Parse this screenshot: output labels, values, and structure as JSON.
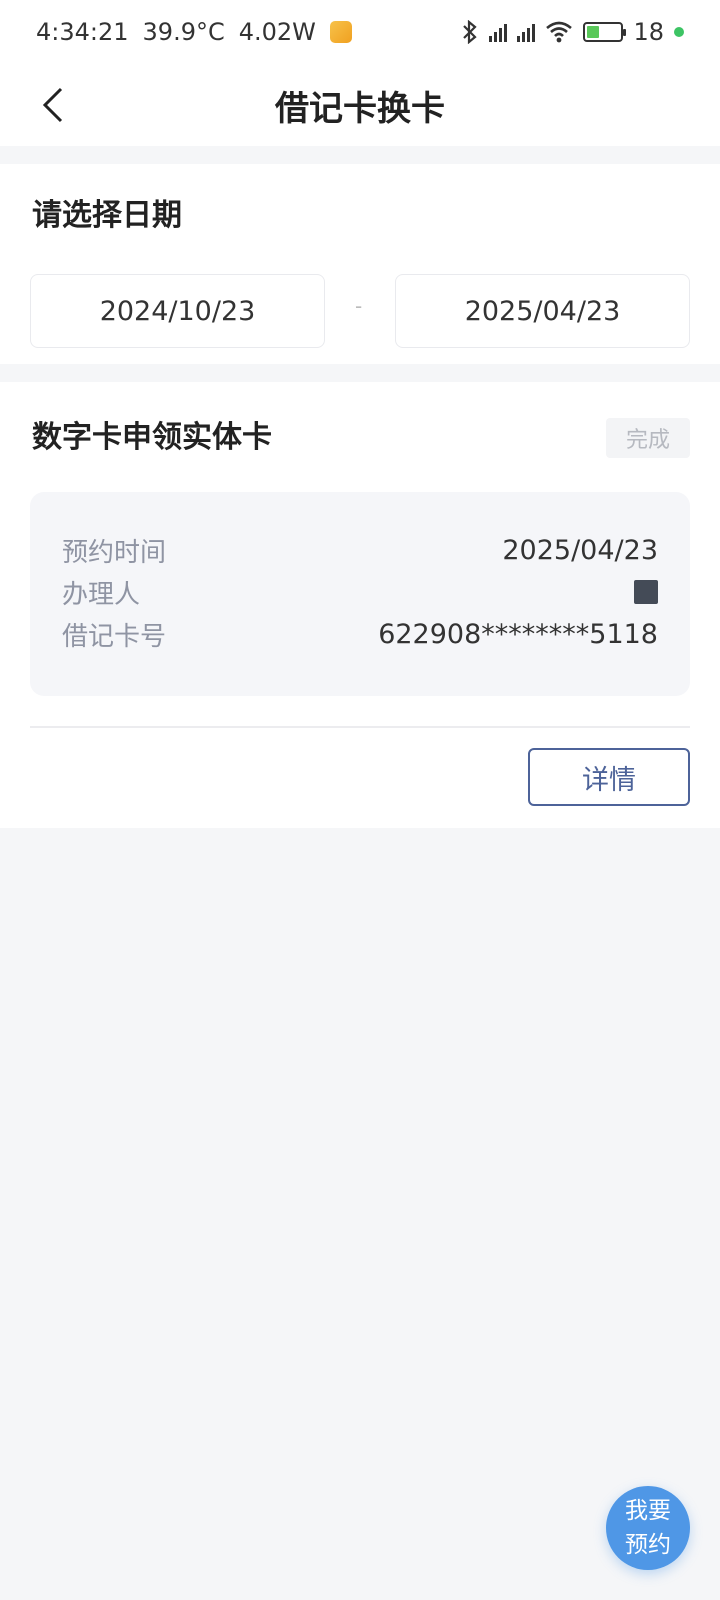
{
  "status_bar": {
    "time": "4:34:21",
    "temperature": "39.9°C",
    "power": "4.02W",
    "battery_level": "18",
    "icons": [
      "bluetooth-icon",
      "signal-icon",
      "signal-icon",
      "wifi-icon",
      "battery-charging-icon"
    ]
  },
  "nav": {
    "title": "借记卡换卡"
  },
  "date_section": {
    "title": "请选择日期",
    "start_date": "2024/10/23",
    "separator": "-",
    "end_date": "2025/04/23"
  },
  "record": {
    "title": "数字卡申领实体卡",
    "status": "完成",
    "rows": [
      {
        "label": "预约时间",
        "value": "2025/04/23"
      },
      {
        "label": "办理人",
        "value": ""
      },
      {
        "label": "借记卡号",
        "value": "622908********5118"
      }
    ],
    "detail_button": "详情"
  },
  "fab": {
    "line1": "我要",
    "line2": "预约"
  },
  "colors": {
    "accent": "#4d6399",
    "fab": "#4f97e6",
    "background": "#f5f6f8"
  }
}
